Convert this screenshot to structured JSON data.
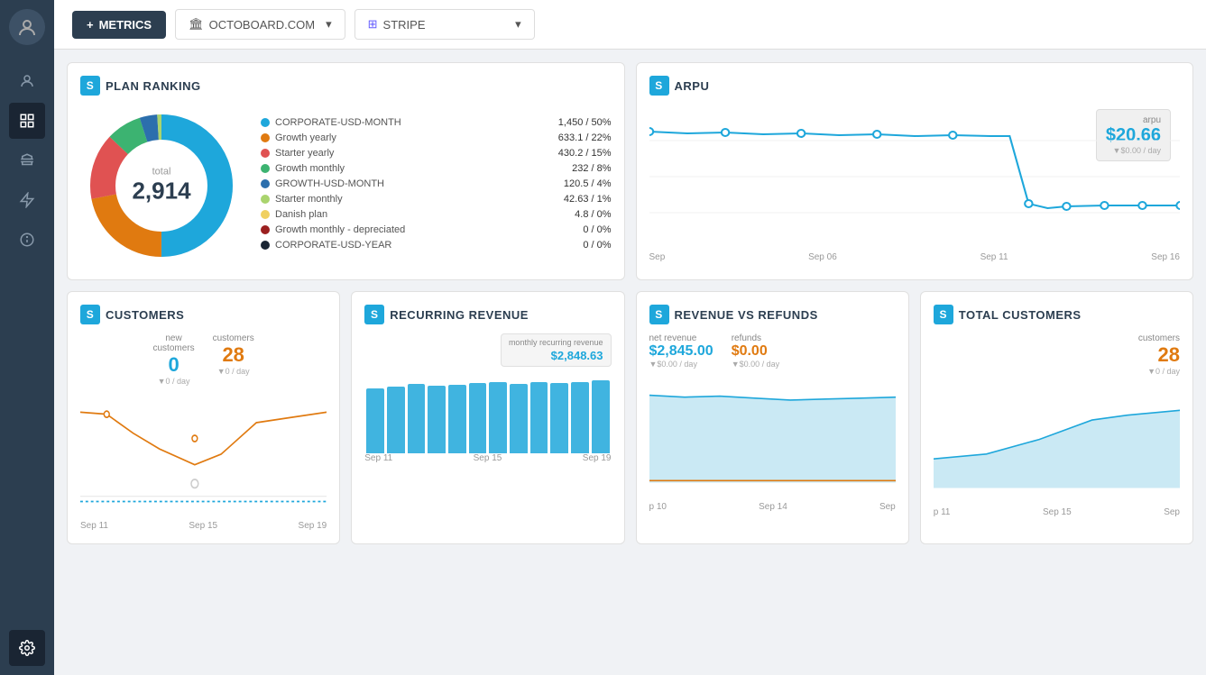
{
  "topbar": {
    "metrics_label": "METRICS",
    "metrics_plus": "+",
    "octoboard_label": "OCTOBOARD.COM",
    "stripe_label": "STRIPE"
  },
  "sidebar": {
    "icons": [
      "user",
      "grid",
      "bank",
      "flash",
      "info",
      "gear"
    ]
  },
  "plan_ranking": {
    "title": "PLAN RANKING",
    "total_label": "total",
    "total_value": "2,914",
    "legend": [
      {
        "name": "CORPORATE-USD-MONTH",
        "value": "1,450 / 50%",
        "color": "#1ea7db"
      },
      {
        "name": "Growth yearly",
        "value": "633.1 / 22%",
        "color": "#e07a10"
      },
      {
        "name": "Starter yearly",
        "value": "430.2 / 15%",
        "color": "#e05252"
      },
      {
        "name": "Growth monthly",
        "value": "232 /  8%",
        "color": "#3cb371"
      },
      {
        "name": "GROWTH-USD-MONTH",
        "value": "120.5 /  4%",
        "color": "#2c6fad"
      },
      {
        "name": "Starter monthly",
        "value": "42.63 /  1%",
        "color": "#aad46e"
      },
      {
        "name": "Danish plan",
        "value": "4.8 /  0%",
        "color": "#f0d060"
      },
      {
        "name": "Growth monthly - depreciated",
        "value": "0 /  0%",
        "color": "#9b2020"
      },
      {
        "name": "CORPORATE-USD-YEAR",
        "value": "0 /  0%",
        "color": "#1a2533"
      }
    ],
    "donut_segments": [
      {
        "color": "#1ea7db",
        "pct": 50
      },
      {
        "color": "#e07a10",
        "pct": 22
      },
      {
        "color": "#e05252",
        "pct": 15
      },
      {
        "color": "#3cb371",
        "pct": 8
      },
      {
        "color": "#2c6fad",
        "pct": 4
      },
      {
        "color": "#aad46e",
        "pct": 1
      }
    ]
  },
  "arpu": {
    "title": "ARPU",
    "tooltip_label": "arpu",
    "tooltip_value": "$20.66",
    "tooltip_sub": "▼$0.00 / day",
    "x_labels": [
      "Sep",
      "Sep 06",
      "Sep 11",
      "Sep 16"
    ]
  },
  "customers": {
    "title": "CUSTOMERS",
    "new_label": "new\ncustomers",
    "new_value": "0",
    "new_sub": "▼0 / day",
    "customers_label": "customers",
    "customers_value": "28",
    "customers_sub": "▼0 / day",
    "x_labels": [
      "Sep 11",
      "Sep 15",
      "Sep 19"
    ]
  },
  "recurring_revenue": {
    "title": "RECURRING REVENUE",
    "tooltip_label": "monthly\nrecurring\nrevenue",
    "tooltip_value": "$2,848.63",
    "bar_heights": [
      80,
      82,
      85,
      83,
      84,
      86,
      88,
      85,
      87,
      86,
      88,
      90
    ],
    "x_labels": [
      "Sep 11",
      "Sep 15",
      "Sep 19"
    ]
  },
  "revenue_vs_refunds": {
    "title": "REVENUE VS REFUNDS",
    "net_revenue_label": "net revenue",
    "net_revenue_value": "$2,845.00",
    "net_revenue_sub": "▼$0.00 / day",
    "refunds_label": "refunds",
    "refunds_value": "$0.00",
    "refunds_sub": "▼$0.00 / day",
    "x_labels": [
      "p 10",
      "Sep 14",
      "Sep"
    ]
  },
  "total_customers": {
    "title": "TOTAL CUSTOMERS",
    "customers_label": "customers",
    "customers_value": "28",
    "customers_sub": "▼0 / day",
    "x_labels": [
      "p 11",
      "Sep 15",
      "Sep"
    ]
  }
}
